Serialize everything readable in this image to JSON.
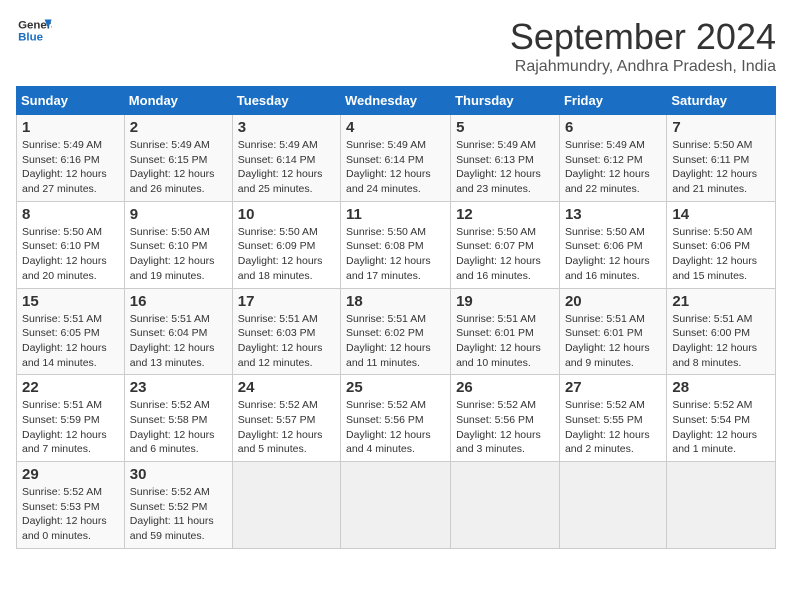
{
  "logo": {
    "line1": "General",
    "line2": "Blue"
  },
  "title": "September 2024",
  "location": "Rajahmundry, Andhra Pradesh, India",
  "headers": [
    "Sunday",
    "Monday",
    "Tuesday",
    "Wednesday",
    "Thursday",
    "Friday",
    "Saturday"
  ],
  "weeks": [
    [
      {
        "day": "1",
        "sunrise": "5:49 AM",
        "sunset": "6:16 PM",
        "daylight": "12 hours and 27 minutes."
      },
      {
        "day": "2",
        "sunrise": "5:49 AM",
        "sunset": "6:15 PM",
        "daylight": "12 hours and 26 minutes."
      },
      {
        "day": "3",
        "sunrise": "5:49 AM",
        "sunset": "6:14 PM",
        "daylight": "12 hours and 25 minutes."
      },
      {
        "day": "4",
        "sunrise": "5:49 AM",
        "sunset": "6:14 PM",
        "daylight": "12 hours and 24 minutes."
      },
      {
        "day": "5",
        "sunrise": "5:49 AM",
        "sunset": "6:13 PM",
        "daylight": "12 hours and 23 minutes."
      },
      {
        "day": "6",
        "sunrise": "5:49 AM",
        "sunset": "6:12 PM",
        "daylight": "12 hours and 22 minutes."
      },
      {
        "day": "7",
        "sunrise": "5:50 AM",
        "sunset": "6:11 PM",
        "daylight": "12 hours and 21 minutes."
      }
    ],
    [
      {
        "day": "8",
        "sunrise": "5:50 AM",
        "sunset": "6:10 PM",
        "daylight": "12 hours and 20 minutes."
      },
      {
        "day": "9",
        "sunrise": "5:50 AM",
        "sunset": "6:10 PM",
        "daylight": "12 hours and 19 minutes."
      },
      {
        "day": "10",
        "sunrise": "5:50 AM",
        "sunset": "6:09 PM",
        "daylight": "12 hours and 18 minutes."
      },
      {
        "day": "11",
        "sunrise": "5:50 AM",
        "sunset": "6:08 PM",
        "daylight": "12 hours and 17 minutes."
      },
      {
        "day": "12",
        "sunrise": "5:50 AM",
        "sunset": "6:07 PM",
        "daylight": "12 hours and 16 minutes."
      },
      {
        "day": "13",
        "sunrise": "5:50 AM",
        "sunset": "6:06 PM",
        "daylight": "12 hours and 16 minutes."
      },
      {
        "day": "14",
        "sunrise": "5:50 AM",
        "sunset": "6:06 PM",
        "daylight": "12 hours and 15 minutes."
      }
    ],
    [
      {
        "day": "15",
        "sunrise": "5:51 AM",
        "sunset": "6:05 PM",
        "daylight": "12 hours and 14 minutes."
      },
      {
        "day": "16",
        "sunrise": "5:51 AM",
        "sunset": "6:04 PM",
        "daylight": "12 hours and 13 minutes."
      },
      {
        "day": "17",
        "sunrise": "5:51 AM",
        "sunset": "6:03 PM",
        "daylight": "12 hours and 12 minutes."
      },
      {
        "day": "18",
        "sunrise": "5:51 AM",
        "sunset": "6:02 PM",
        "daylight": "12 hours and 11 minutes."
      },
      {
        "day": "19",
        "sunrise": "5:51 AM",
        "sunset": "6:01 PM",
        "daylight": "12 hours and 10 minutes."
      },
      {
        "day": "20",
        "sunrise": "5:51 AM",
        "sunset": "6:01 PM",
        "daylight": "12 hours and 9 minutes."
      },
      {
        "day": "21",
        "sunrise": "5:51 AM",
        "sunset": "6:00 PM",
        "daylight": "12 hours and 8 minutes."
      }
    ],
    [
      {
        "day": "22",
        "sunrise": "5:51 AM",
        "sunset": "5:59 PM",
        "daylight": "12 hours and 7 minutes."
      },
      {
        "day": "23",
        "sunrise": "5:52 AM",
        "sunset": "5:58 PM",
        "daylight": "12 hours and 6 minutes."
      },
      {
        "day": "24",
        "sunrise": "5:52 AM",
        "sunset": "5:57 PM",
        "daylight": "12 hours and 5 minutes."
      },
      {
        "day": "25",
        "sunrise": "5:52 AM",
        "sunset": "5:56 PM",
        "daylight": "12 hours and 4 minutes."
      },
      {
        "day": "26",
        "sunrise": "5:52 AM",
        "sunset": "5:56 PM",
        "daylight": "12 hours and 3 minutes."
      },
      {
        "day": "27",
        "sunrise": "5:52 AM",
        "sunset": "5:55 PM",
        "daylight": "12 hours and 2 minutes."
      },
      {
        "day": "28",
        "sunrise": "5:52 AM",
        "sunset": "5:54 PM",
        "daylight": "12 hours and 1 minute."
      }
    ],
    [
      {
        "day": "29",
        "sunrise": "5:52 AM",
        "sunset": "5:53 PM",
        "daylight": "12 hours and 0 minutes."
      },
      {
        "day": "30",
        "sunrise": "5:52 AM",
        "sunset": "5:52 PM",
        "daylight": "11 hours and 59 minutes."
      },
      null,
      null,
      null,
      null,
      null
    ]
  ]
}
